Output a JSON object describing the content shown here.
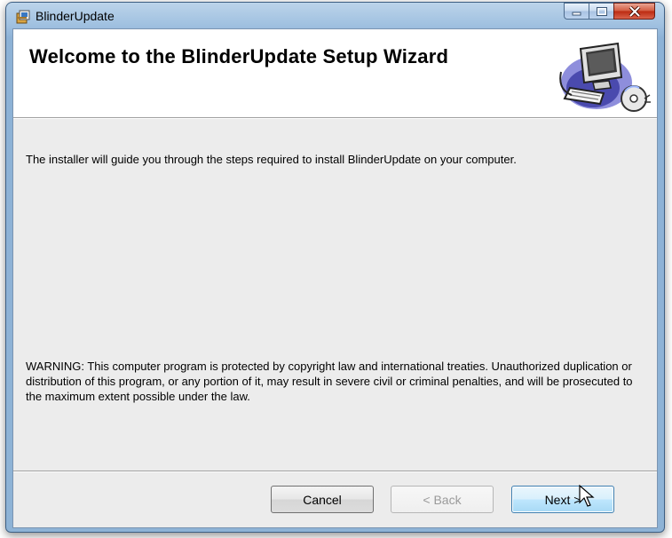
{
  "window": {
    "title": "BlinderUpdate",
    "app_icon": "installer-package-icon",
    "caption_buttons": [
      "minimize-icon",
      "maximize-icon",
      "close-icon"
    ]
  },
  "banner": {
    "title": "Welcome to the BlinderUpdate Setup Wizard",
    "icon": "computer-setup-icon"
  },
  "body": {
    "intro": "The installer will guide you through the steps required to install BlinderUpdate on your computer.",
    "warning": "WARNING: This computer program is protected by copyright law and international treaties. Unauthorized duplication or distribution of this program, or any portion of it, may result in severe civil or criminal penalties, and will be prosecuted to the maximum extent possible under the law."
  },
  "buttons": {
    "cancel": "Cancel",
    "back": "< Back",
    "next": "Next >",
    "back_enabled": false
  },
  "colors": {
    "frame": "#9fc0e0",
    "close_button": "#c8381b",
    "client_background": "#ececec"
  }
}
